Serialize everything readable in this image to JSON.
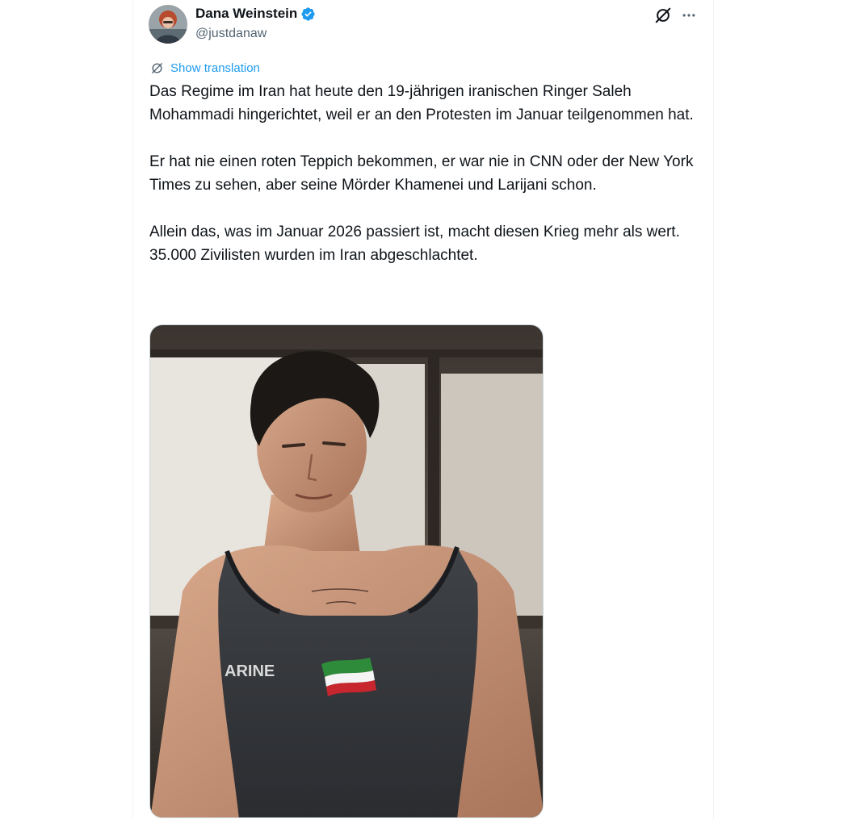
{
  "author": {
    "name": "Dana Weinstein",
    "handle": "@justdanaw",
    "verified": true,
    "avatar_icon": "avatar-photo"
  },
  "actions": {
    "grok_icon": "grok-icon",
    "more_icon": "more-options-icon"
  },
  "translation": {
    "label": "Show translation",
    "icon": "translate-icon"
  },
  "tweet": {
    "paragraphs": [
      "Das Regime im Iran hat heute den 19-jährigen iranischen Ringer Saleh Mohammadi hingerichtet, weil er an den Protesten im Januar teilgenommen hat.",
      "Er hat nie einen roten Teppich bekommen, er war nie in CNN oder der New York Times zu sehen, aber seine Mörder Khamenei und Larijani schon.",
      "Allein das, was im Januar 2026 passiert ist, macht diesen Krieg mehr als wert. 35.000 Zivilisten wurden im Iran abgeschlachtet."
    ],
    "media": {
      "singlet_text": "ARINE"
    }
  },
  "colors": {
    "accent": "#1d9bf0",
    "text": "#0f1419",
    "secondary": "#536471"
  }
}
